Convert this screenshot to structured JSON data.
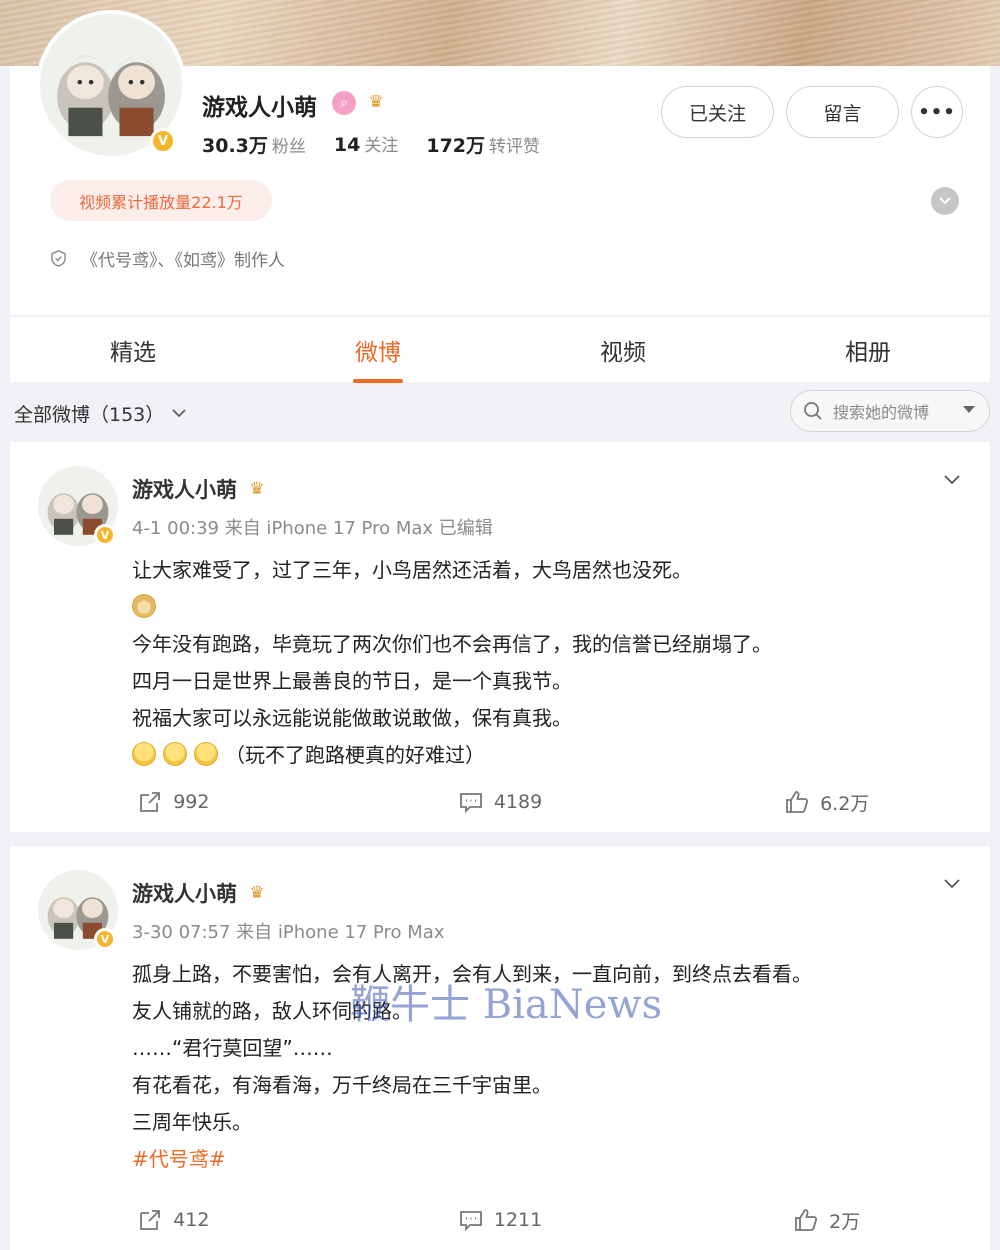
{
  "profile": {
    "name": "游戏人小萌",
    "verified_icon": "v-verified-icon",
    "stats": [
      {
        "value": "30.3万",
        "label": "粉丝"
      },
      {
        "value": "14",
        "label": "关注"
      },
      {
        "value": "172万",
        "label": "转评赞"
      }
    ],
    "buttons": {
      "follow": "已关注",
      "message": "留言",
      "more": "•••"
    },
    "video_plays": "视频累计播放量22.1万",
    "bio": "《代号鸢》、《如鸢》制作人"
  },
  "tabs": [
    {
      "label": "精选",
      "active": false
    },
    {
      "label": "微博",
      "active": true
    },
    {
      "label": "视频",
      "active": false
    },
    {
      "label": "相册",
      "active": false
    }
  ],
  "filter": {
    "label": "全部微博（153）"
  },
  "search": {
    "placeholder": "搜索她的微博"
  },
  "posts": [
    {
      "author": "游戏人小萌",
      "meta": "4-1 00:39 来自 iPhone 17 Pro Max 已编辑",
      "lines": [
        "让大家难受了，过了三年，小鸟居然还活着，大鸟居然也没死。",
        "",
        "今年没有跑路，毕竟玩了两次你们也不会再信了，我的信誉已经崩塌了。",
        "四月一日是世界上最善良的节日，是一个真我节。",
        "祝福大家可以永远能说能做敢说敢做，保有真我。",
        "（玩不了跑路梗真的好难过）"
      ],
      "reposts": "992",
      "comments": "4189",
      "likes": "6.2万"
    },
    {
      "author": "游戏人小萌",
      "meta": "3-30 07:57 来自 iPhone 17 Pro Max",
      "lines": [
        "孤身上路，不要害怕，会有人离开，会有人到来，一直向前，到终点去看看。",
        "友人铺就的路，敌人环伺的路。",
        "……“君行莫回望”……",
        "有花看花，有海看海，万千终局在三千宇宙里。",
        "三周年快乐。"
      ],
      "tag": "#代号鸢#",
      "reposts": "412",
      "comments": "1211",
      "likes": "2万"
    }
  ],
  "watermark": "鞭牛士 BiaNews",
  "colors": {
    "accent": "#ee6a22",
    "verified": "#f7b52c",
    "pill_bg": "#fbeeea"
  }
}
